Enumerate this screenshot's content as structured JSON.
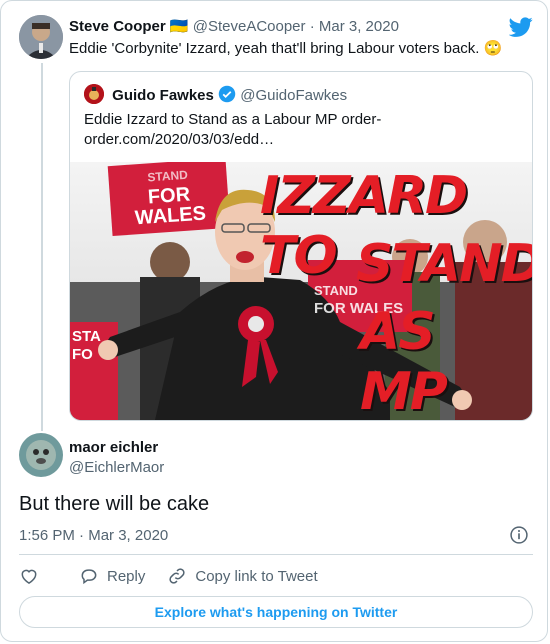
{
  "tweet": {
    "author_name": "Steve Cooper",
    "flag": "🇺🇦",
    "handle": "@SteveACooper",
    "date": "Mar 3, 2020",
    "separator": "·",
    "text": "Eddie 'Corbynite' Izzard, yeah that'll bring Labour voters back.",
    "emoji": "🙄"
  },
  "quote": {
    "author_name": "Guido Fawkes",
    "handle": "@GuidoFawkes",
    "text": "Eddie Izzard to Stand as a Labour MP order-order.com/2020/03/03/edd…",
    "image": {
      "headline_line1": "IZZARD TO",
      "headline_line2": "STAND",
      "headline_line3": "AS MP",
      "sign1_line1": "STAND",
      "sign1_line2": "FOR WALES",
      "sign2_line1": "STAND",
      "sign2_line2": "FOR WALES",
      "sign3_text": "STA",
      "sign3_sub": "FO"
    }
  },
  "reply": {
    "author_name": "maor eichler",
    "handle": "@EichlerMaor",
    "text": "But there will be cake",
    "time": "1:56 PM",
    "separator": "·",
    "date": "Mar 3, 2020"
  },
  "actions": {
    "reply_label": "Reply",
    "copy_label": "Copy link to Tweet"
  },
  "explore_label": "Explore what's happening on Twitter",
  "colors": {
    "accent": "#1d9bf0",
    "verified": "#1d9bf0",
    "headline_red": "#e41e26",
    "labour_red": "#d21f3c"
  }
}
